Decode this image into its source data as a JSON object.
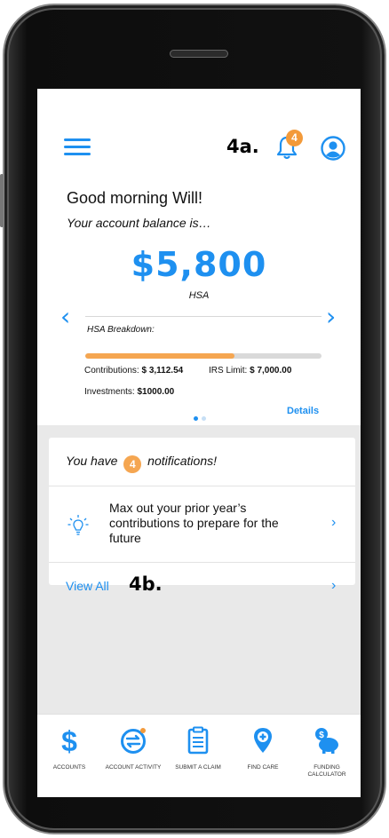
{
  "header": {
    "annotation_a": "4a.",
    "notification_count": "4"
  },
  "hero": {
    "greeting": "Good morning Will!",
    "subtitle": "Your account balance is…",
    "balance": "$5,800",
    "account_type": "HSA",
    "breakdown_label": "HSA Breakdown:",
    "progress_fraction": 0.63,
    "contributions_label": "Contributions:",
    "contributions_value": "$ 3,112.54",
    "irs_limit_label": "IRS Limit:",
    "irs_limit_value": "$ 7,000.00",
    "investments_label": "Investments:",
    "investments_value": "$1000.00",
    "details_link": "Details",
    "pager": {
      "count": 2,
      "active": 0
    }
  },
  "notifications": {
    "prefix": "You have",
    "count": "4",
    "suffix": "notifications!",
    "item_text": "Max out your prior year’s contributions to prepare for the future",
    "view_all": "View All",
    "annotation_b": "4b."
  },
  "bottom_nav": {
    "items": [
      {
        "label": "ACCOUNTS",
        "icon": "dollar-icon"
      },
      {
        "label": "ACCOUNT ACTIVITY",
        "icon": "exchange-icon"
      },
      {
        "label": "SUBMIT A CLAIM",
        "icon": "clipboard-icon"
      },
      {
        "label": "FIND CARE",
        "icon": "location-plus-icon"
      },
      {
        "label": "FUNDING CALCULATOR",
        "icon": "piggy-bank-icon"
      }
    ]
  },
  "colors": {
    "accent": "#1e90f0",
    "orange": "#f5a651",
    "screen_bg": "#e9e9e9"
  }
}
